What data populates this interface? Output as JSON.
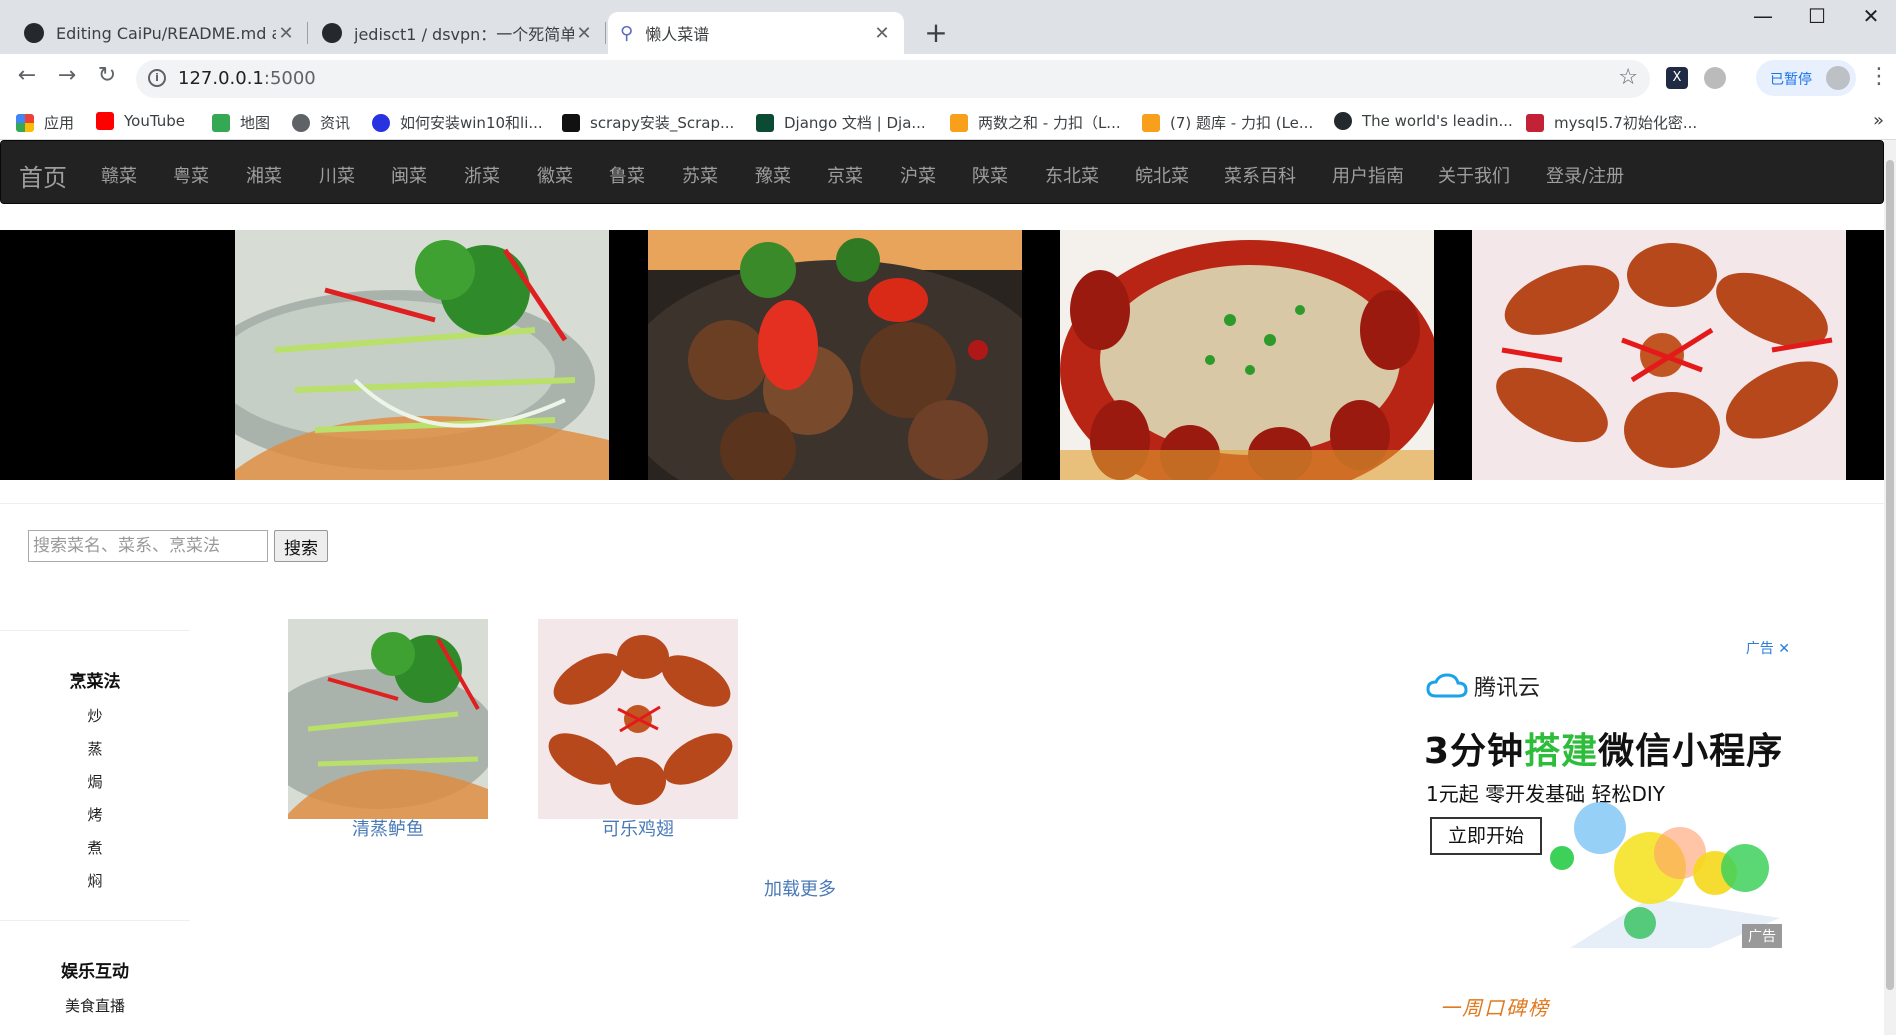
{
  "browser": {
    "tabs": [
      {
        "title": "Editing CaiPu/README.md at",
        "icon": "github-icon"
      },
      {
        "title": "jedisct1 / dsvpn：一个死简单的",
        "icon": "github-icon"
      },
      {
        "title": "懒人菜谱",
        "icon": "page-icon"
      }
    ],
    "url_host": "127.0.0.1",
    "url_port": ":5000",
    "profile_label": "已暂停",
    "bookmarks": [
      {
        "label": "应用"
      },
      {
        "label": "YouTube"
      },
      {
        "label": "地图"
      },
      {
        "label": "资讯"
      },
      {
        "label": "如何安装win10和li..."
      },
      {
        "label": "scrapy安装_Scrap..."
      },
      {
        "label": "Django 文档 | Dja..."
      },
      {
        "label": "两数之和 - 力扣（L..."
      },
      {
        "label": "(7) 题库 - 力扣 (Le..."
      },
      {
        "label": "The world's leadin..."
      },
      {
        "label": "mysql5.7初始化密..."
      }
    ],
    "bookmark_more": "»"
  },
  "site": {
    "brand": "首页",
    "nav": [
      "赣菜",
      "粤菜",
      "湘菜",
      "川菜",
      "闽菜",
      "浙菜",
      "徽菜",
      "鲁菜",
      "苏菜",
      "豫菜",
      "京菜",
      "沪菜",
      "陕菜",
      "东北菜",
      "皖北菜",
      "菜系百科",
      "用户指南",
      "关于我们",
      "登录/注册"
    ],
    "search": {
      "placeholder": "搜索菜名、菜系、烹菜法",
      "button": "搜索"
    },
    "sidebar": {
      "cooking_title": "烹菜法",
      "cooking_items": [
        "炒",
        "蒸",
        "焗",
        "烤",
        "煮",
        "焖"
      ],
      "fun_title": "娱乐互动",
      "fun_items": [
        "美食直播"
      ]
    },
    "dishes": [
      {
        "name": "清蒸鲈鱼"
      },
      {
        "name": "可乐鸡翅"
      }
    ],
    "load_more": "加载更多",
    "ad": {
      "tag": "广告 ✕",
      "brand": "腾讯云",
      "headline_a": "3分钟",
      "headline_b": "搭建",
      "headline_c": "微信小程序",
      "sub": "1元起  零开发基础  轻松DIY",
      "cta": "立即开始",
      "corner": "广告"
    },
    "koubei": "一周口碑榜"
  }
}
